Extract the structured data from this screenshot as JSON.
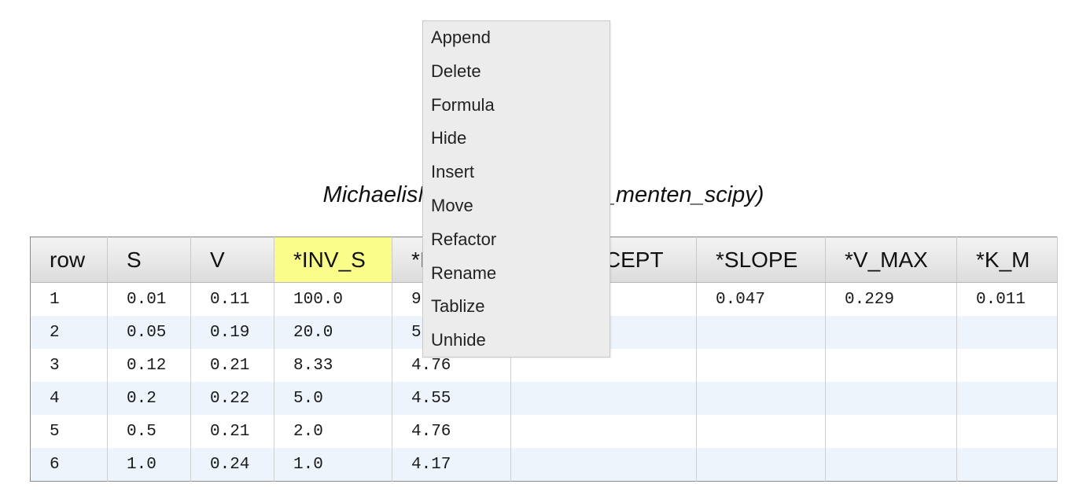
{
  "title": "MichaelisMenten (michaelis_menten_scipy)",
  "table": {
    "headers": [
      "row",
      "S",
      "V",
      "*INV_S",
      "*INV_V",
      "*INTERCEPT",
      "*SLOPE",
      "*V_MAX",
      "*K_M"
    ],
    "highlighted_column": "*INV_S",
    "rows": [
      [
        "1",
        "0.01",
        "0.11",
        "100.0",
        "9.09",
        "",
        "0.047",
        "0.229",
        "0.011"
      ],
      [
        "2",
        "0.05",
        "0.19",
        "20.0",
        "5.26",
        "",
        "",
        "",
        ""
      ],
      [
        "3",
        "0.12",
        "0.21",
        "8.33",
        "4.76",
        "",
        "",
        "",
        ""
      ],
      [
        "4",
        "0.2",
        "0.22",
        "5.0",
        "4.55",
        "",
        "",
        "",
        ""
      ],
      [
        "5",
        "0.5",
        "0.21",
        "2.0",
        "4.76",
        "",
        "",
        "",
        ""
      ],
      [
        "6",
        "1.0",
        "0.24",
        "1.0",
        "4.17",
        "",
        "",
        "",
        ""
      ]
    ]
  },
  "context_menu": {
    "items": [
      "Append",
      "Delete",
      "Formula",
      "Hide",
      "Insert",
      "Move",
      "Refactor",
      "Rename",
      "Tablize",
      "Unhide"
    ]
  },
  "colors": {
    "header_highlight": "#fbfd8a",
    "row_stripe": "#edf4fb",
    "menu_background": "#ececec"
  }
}
